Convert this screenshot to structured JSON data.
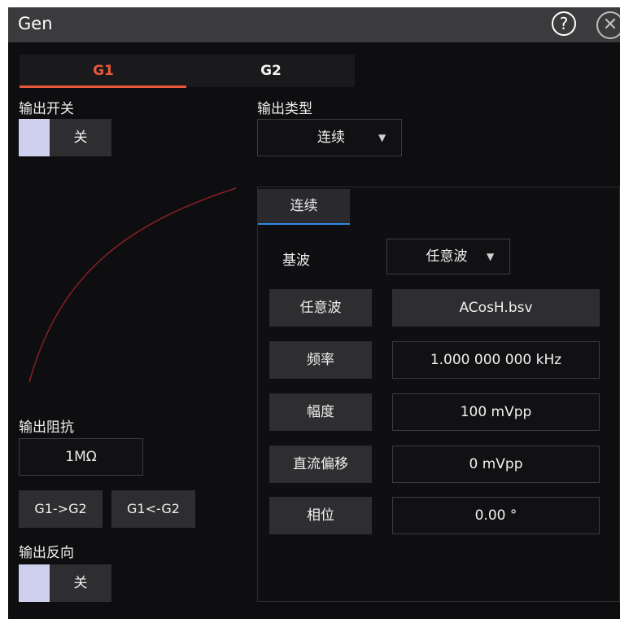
{
  "window": {
    "title": "Gen",
    "help_icon": "?",
    "close_icon": "✕"
  },
  "tabs": [
    {
      "label": "G1",
      "active": true
    },
    {
      "label": "G2",
      "active": false
    }
  ],
  "output_switch": {
    "label": "输出开关",
    "state": "关"
  },
  "output_type": {
    "label": "输出类型",
    "value": "连续",
    "caret": "▼"
  },
  "output_impedance": {
    "label": "输出阻抗",
    "value": "1MΩ"
  },
  "copy_buttons": {
    "g1_to_g2": "G1->G2",
    "g1_from_g2": "G1<-G2"
  },
  "output_invert": {
    "label": "输出反向",
    "state": "关"
  },
  "panel": {
    "tab": "连续",
    "base_wave": {
      "label": "基波",
      "value": "任意波",
      "caret": "▼"
    },
    "params": [
      {
        "label": "任意波",
        "value": "ACosH.bsv"
      },
      {
        "label": "频率",
        "value": "1.000 000 000 kHz"
      },
      {
        "label": "幅度",
        "value": "100 mVpp"
      },
      {
        "label": "直流偏移",
        "value": "0 mVpp"
      },
      {
        "label": "相位",
        "value": "0.00 °"
      }
    ]
  },
  "colors": {
    "accent": "#e8583a",
    "tab_underline": "#2f88e0",
    "toggle_knob": "#cfd0ee",
    "preview_curve": "#8a1f26"
  }
}
